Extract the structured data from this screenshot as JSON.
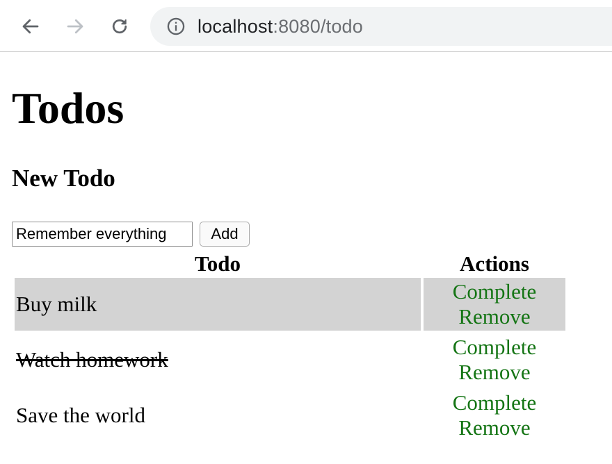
{
  "browser": {
    "url_host": "localhost",
    "url_path": ":8080/todo",
    "back_icon": "arrow-left",
    "forward_icon": "arrow-right",
    "reload_icon": "reload",
    "info_icon": "info-circle"
  },
  "page": {
    "title": "Todos",
    "new_todo_heading": "New Todo",
    "input_value": "Remember everything",
    "add_label": "Add"
  },
  "table": {
    "headers": [
      "Todo",
      "Actions"
    ],
    "rows": [
      {
        "text": "Buy milk",
        "completed": false,
        "highlighted": true,
        "complete_label": "Complete",
        "remove_label": "Remove"
      },
      {
        "text": "Watch homework",
        "completed": true,
        "highlighted": false,
        "complete_label": "Complete",
        "remove_label": "Remove"
      },
      {
        "text": "Save the world",
        "completed": false,
        "highlighted": false,
        "complete_label": "Complete",
        "remove_label": "Remove"
      }
    ]
  },
  "colors": {
    "link": "#157515",
    "highlight_row": "#d3d3d3",
    "omnibox_bg": "#f1f3f4"
  }
}
